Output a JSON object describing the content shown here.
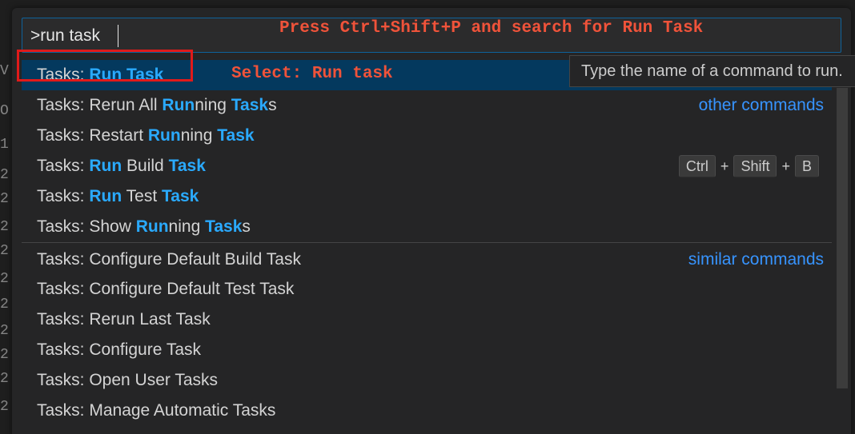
{
  "palette": {
    "input_value": ">run task",
    "annotation_top": "Press Ctrl+Shift+P and search for Run Task",
    "annotation_select": "Select: Run task",
    "tooltip": "Type the name of a command to run."
  },
  "items": [
    {
      "prefix": "Tasks: ",
      "parts": [
        {
          "t": "Run",
          "h": true
        },
        {
          "t": " ",
          "h": false
        },
        {
          "t": "Task",
          "h": true
        }
      ],
      "right_link": ""
    },
    {
      "prefix": "Tasks: Rerun All ",
      "parts": [
        {
          "t": "Run",
          "h": true
        },
        {
          "t": "ning ",
          "h": false
        },
        {
          "t": "Task",
          "h": true
        },
        {
          "t": "s",
          "h": false
        }
      ],
      "right_link": "other commands"
    },
    {
      "prefix": "Tasks: Restart ",
      "parts": [
        {
          "t": "Run",
          "h": true
        },
        {
          "t": "ning ",
          "h": false
        },
        {
          "t": "Task",
          "h": true
        }
      ],
      "right_link": ""
    },
    {
      "prefix": "Tasks: ",
      "parts": [
        {
          "t": "Run",
          "h": true
        },
        {
          "t": " Build ",
          "h": false
        },
        {
          "t": "Task",
          "h": true
        }
      ],
      "right_link": "",
      "keybinding": [
        "Ctrl",
        "Shift",
        "B"
      ]
    },
    {
      "prefix": "Tasks: ",
      "parts": [
        {
          "t": "Run",
          "h": true
        },
        {
          "t": " Test ",
          "h": false
        },
        {
          "t": "Task",
          "h": true
        }
      ],
      "right_link": ""
    },
    {
      "prefix": "Tasks: Show ",
      "parts": [
        {
          "t": "Run",
          "h": true
        },
        {
          "t": "ning ",
          "h": false
        },
        {
          "t": "Task",
          "h": true
        },
        {
          "t": "s",
          "h": false
        }
      ],
      "right_link": ""
    },
    {
      "prefix": "Tasks: Configure Default Build Task",
      "parts": [],
      "right_link": "similar commands"
    },
    {
      "prefix": "Tasks: Configure Default Test Task",
      "parts": [],
      "right_link": ""
    },
    {
      "prefix": "Tasks: Rerun Last Task",
      "parts": [],
      "right_link": ""
    },
    {
      "prefix": "Tasks: Configure Task",
      "parts": [],
      "right_link": ""
    },
    {
      "prefix": "Tasks: Open User Tasks",
      "parts": [],
      "right_link": ""
    },
    {
      "prefix": "Tasks: Manage Automatic Tasks",
      "parts": [],
      "right_link": ""
    }
  ],
  "keybinding_separator": "+",
  "background_fragments": [
    "V",
    "O",
    "1",
    "2",
    "2",
    "2",
    "2",
    "2",
    "2",
    "2",
    "2",
    "2",
    "2"
  ],
  "colors": {
    "accent_highlight": "#2aaaff",
    "annotation": "#f0533a",
    "selection": "#04395e",
    "callout_border": "#e01a1a"
  }
}
